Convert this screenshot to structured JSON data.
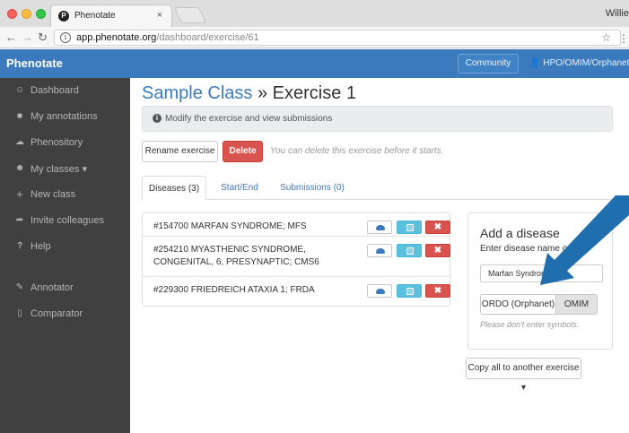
{
  "browser": {
    "tab_title": "Phenotate",
    "tab_close": "×",
    "profile_name": "Willie",
    "url_host": "app.phenotate.org",
    "url_path": "/dashboard/exercise/61",
    "icons": [
      "back-arrow-icon",
      "forward-arrow-icon",
      "reload-icon",
      "info-icon",
      "star-icon",
      "menu-icon"
    ]
  },
  "navbar": {
    "brand": "Phenotate",
    "community": "Community",
    "ontology_menu": "👤 HPO/OMIM/Orphanet ▾",
    "accent": "#3a7abd"
  },
  "sidebar": {
    "background": "#404040",
    "items": [
      {
        "icon": "dashboard-icon",
        "glyph": "☺",
        "label": "Dashboard"
      },
      {
        "icon": "folder-icon",
        "glyph": "■",
        "label": "My annotations"
      },
      {
        "icon": "cloud-icon",
        "glyph": "☁",
        "label": "Phenository"
      },
      {
        "icon": "users-icon",
        "glyph": "☻",
        "label": "My classes ▾"
      },
      {
        "icon": "plus-icon",
        "glyph": "+",
        "label": "New class"
      },
      {
        "icon": "share-icon",
        "glyph": "➦",
        "label": "Invite colleagues"
      },
      {
        "icon": "help-icon",
        "glyph": "?",
        "label": "Help"
      },
      {
        "icon": "pencil-icon",
        "glyph": "✎",
        "label": "Annotator"
      },
      {
        "icon": "columns-icon",
        "glyph": "▯",
        "label": "Comparator"
      }
    ]
  },
  "main": {
    "title_class": "Sample Class",
    "title_sep": "»",
    "title_exercise": "Exercise 1",
    "alert_text": "Modify the exercise and view submissions",
    "rename_label": "Rename exercise",
    "delete_label": "Delete",
    "delete_hint": "You can delete this exercise before it starts.",
    "tabs": [
      {
        "label": "Diseases (3)",
        "active": true
      },
      {
        "label": "Start/End",
        "active": false
      },
      {
        "label": "Submissions (0)",
        "active": false
      }
    ],
    "diseases": [
      {
        "name": "#154700 MARFAN SYNDROME; MFS"
      },
      {
        "name": "#254210 MYASTHENIC SYNDROME, CONGENITAL, 6, PRESYNAPTIC; CMS6"
      },
      {
        "name": "#229300 FRIEDREICH ATAXIA 1; FRDA"
      }
    ],
    "remove_glyph": "✖",
    "add_panel": {
      "title": "Add a disease",
      "label": "Enter disease name or ID:",
      "input_value": "Marfan Syndrome",
      "option_ordo": "ORDO (Orphanet)",
      "option_omim": "OMIM",
      "selected": "OMIM",
      "hint": "Please don't enter symbols."
    },
    "copy_all_label": "Copy all to another exercise ▾"
  },
  "colors": {
    "danger": "#d9534f",
    "info": "#5bc0de",
    "annotation_arrow": "#1f6fae"
  }
}
